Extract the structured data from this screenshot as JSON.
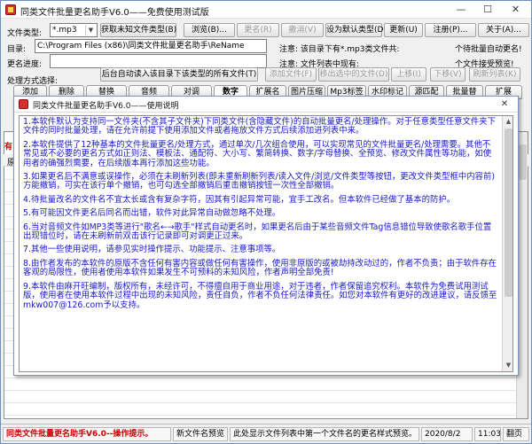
{
  "window": {
    "title": "同类文件批量更名助手V6.0——免费使用测试版",
    "min_symbol": "—",
    "max_symbol": "☐",
    "close_symbol": "✕"
  },
  "toolbar": {
    "file_type_label": "文件类型:",
    "file_type_value": "*.mp3",
    "get_unknown_type_button": "获取未知文件类型(B)",
    "browse_button": "浏览(B)...",
    "rename_button": "更名(R)",
    "undo_button": "撤消(V)",
    "set_default_button": "设为默认类型(D)",
    "update_button": "更新(U)",
    "register_button": "注册(P)...",
    "about_button": "关于(A)..."
  },
  "dir": {
    "label": "目录:",
    "value": "C:\\Program Files (x86)\\同类文件批量更名助手\\ReName",
    "note1": "注意: 该目录下有*.mp3类文件共:",
    "count1": "个待批量自动更名!",
    "note2": "注意: 文件列表中现有:",
    "count2": "个文件接受预览!"
  },
  "progress": {
    "label": "更名进度:"
  },
  "options": {
    "label": "处理方式选择:",
    "auto_read_button": "后台自动读入该目录下该类型的所有文件(T)",
    "add_file_button": "添加文件(F)",
    "remove_selected_button": "移出选中的文件(D)",
    "move_up_button": "上移(I)",
    "move_down_button": "下移(V)",
    "refresh_list_button": "刷新列表(K)"
  },
  "tabs": [
    {
      "label": "添加"
    },
    {
      "label": "删除"
    },
    {
      "label": "替换"
    },
    {
      "label": "音频"
    },
    {
      "label": "对调"
    },
    {
      "label": "数字"
    },
    {
      "label": "扩展名"
    },
    {
      "label": "图片压缩"
    },
    {
      "label": "Mp3标签"
    },
    {
      "label": "水印标记"
    },
    {
      "label": "源匹配"
    },
    {
      "label": "批量替"
    },
    {
      "label": "扩展"
    }
  ],
  "list": {
    "side_label": "有",
    "header_label": "原"
  },
  "dialog": {
    "title": "同类文件批量更名助手V6.0——使用说明",
    "close_symbol": "✕",
    "paragraphs": [
      "1.本软件默认为支持同一文件夹(不含其子文件夹)下同类文件(含隐藏文件)的自动批量更名/处理操作。对于任意类型任意文件夹下文件的同时批量处理，请在允许前提下使用添加文件或者拖放文件方式后续添加进列表中来。",
      "2.本软件提供了12种基本的文件批量更名/处理方式，通过单次/几次组合使用，可以实现常见的文件批量更名/处理需要。其他不常见或不必要的更名方式如正则法、模板法、通配符、大小写、繁简转换、数字/字母替换、全预览、修改文件属性等功能，如使用者的确强烈需要，在后续版本再行添加这些功能。",
      "3.如果更名后不满意或误操作，必须在未刷新列表(即未重新刷新列表/读入文件/浏览/文件类型等按钮，更改文件类型框中内容前)方能撤销，可实在该行单个撤销，也可勾选全部撤销后重击撤销按钮一次性全部撤销。",
      "4.待批量改名的文件名不宜太长或含有复杂字符，因其有引起异常可能，宜手工改名。但本软件已经做了基本的防护。",
      "5.有可能因文件更名后同名而出错，软件对此异常自动做忽略不处理。",
      "6.当对音频文件如MP3类等进行\"歌名←→歌手\"样式自动更名时，如果更名后由于某些音频文件Tag信息错位导致使歌名歌手位置出现错位时，请在未刷新前双击该行记录即可对调更正过来。",
      "7.其他一些使用说明，请参见实时操作提示、功能提示、注意事项等。",
      "8.由作者发布的本软件的原版不含任何有害内容或做任何有害操作，使用非原版的或被劫持改动过的，作者不负责；由于软件存在客观的局限性，使用者使用本软件如果发生不可预料的未知风险，作者声明全部免责!",
      "9.本软件由麻开旺编制，版权所有，未经许可，不得擅自用于商业用途，对于违者，作者保留追究权利。本软件为免费试用测试版，使用者在使用本软件过程中出现的未知风险，责任自负，作者不负任何法律责任。如您对本软件有更好的改进建议，请反馈至mkw007@126.com予以支持。"
    ]
  },
  "status": {
    "app_label": "同类文件批量更名助手V6.0--操作提示。",
    "preview_label": "新文件名预览",
    "hint": "此处显示文件列表中第一个文件名的更名样式预览。",
    "date": "2020/8/2",
    "time": "11:03",
    "page_button": "翻页"
  }
}
